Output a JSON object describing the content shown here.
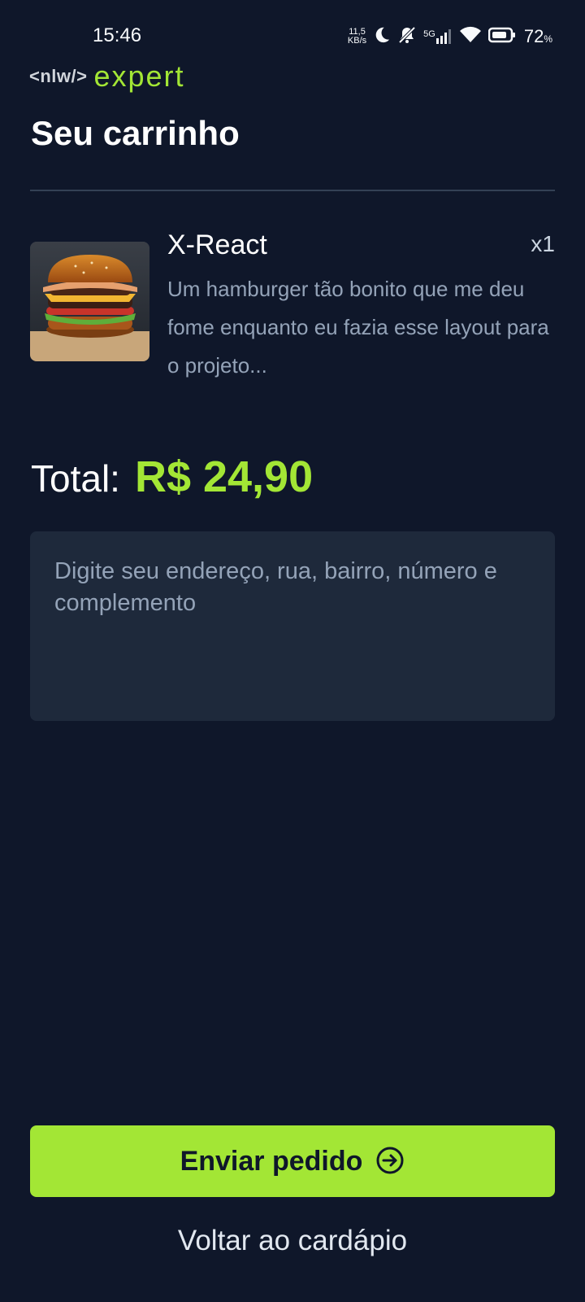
{
  "status_bar": {
    "time": "15:46",
    "net_speed_value": "11,5",
    "net_speed_unit": "KB/s",
    "network_label": "5G",
    "battery_percent": "72",
    "battery_unit": "%"
  },
  "brand": {
    "tag": "<nlw/>",
    "name": "expert",
    "accent_color": "#a3e635"
  },
  "page": {
    "title": "Seu carrinho"
  },
  "cart": {
    "items": [
      {
        "name": "X-React",
        "quantity": "x1",
        "description": "Um hamburger tão bonito que me deu fome enquanto eu fazia esse layout para o projeto...",
        "image_icon": "burger-image"
      }
    ]
  },
  "total": {
    "label": "Total:",
    "value": "R$ 24,90"
  },
  "address": {
    "placeholder": "Digite seu endereço, rua, bairro, número e complemento",
    "value": ""
  },
  "actions": {
    "send_label": "Enviar pedido",
    "send_icon": "arrow-right-circle-icon",
    "back_label": "Voltar ao cardápio"
  },
  "colors": {
    "background": "#0f172a",
    "surface": "#1e293b",
    "accent": "#a3e635",
    "muted_text": "#94a3b8"
  }
}
